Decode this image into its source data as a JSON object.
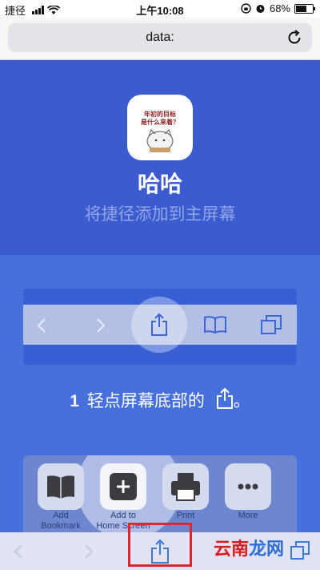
{
  "statusbar": {
    "carrier": "捷径",
    "network": "",
    "time": "上午10:08",
    "battery": "68%"
  },
  "browser": {
    "url": "data:"
  },
  "hero": {
    "app_name": "哈哈",
    "subtitle": "将捷径添加到主屏幕",
    "icon_text": "年初的目标\n是什么来着？"
  },
  "instruction": {
    "number": "1",
    "text": "轻点屏幕底部的",
    "suffix": "。"
  },
  "share_sheet": {
    "actions": [
      {
        "label": "Add\nBookmark",
        "icon": "book-icon"
      },
      {
        "label": "Add to\nHome Screen",
        "icon": "plus-icon"
      },
      {
        "label": "Print",
        "icon": "printer-icon"
      },
      {
        "label": "More",
        "icon": "more-icon"
      }
    ]
  },
  "watermark": {
    "part1": "云南",
    "part2": "龙网"
  },
  "colors": {
    "hero": "#3b5bcf",
    "section": "#4670dc",
    "highlight": "#e0262b"
  }
}
